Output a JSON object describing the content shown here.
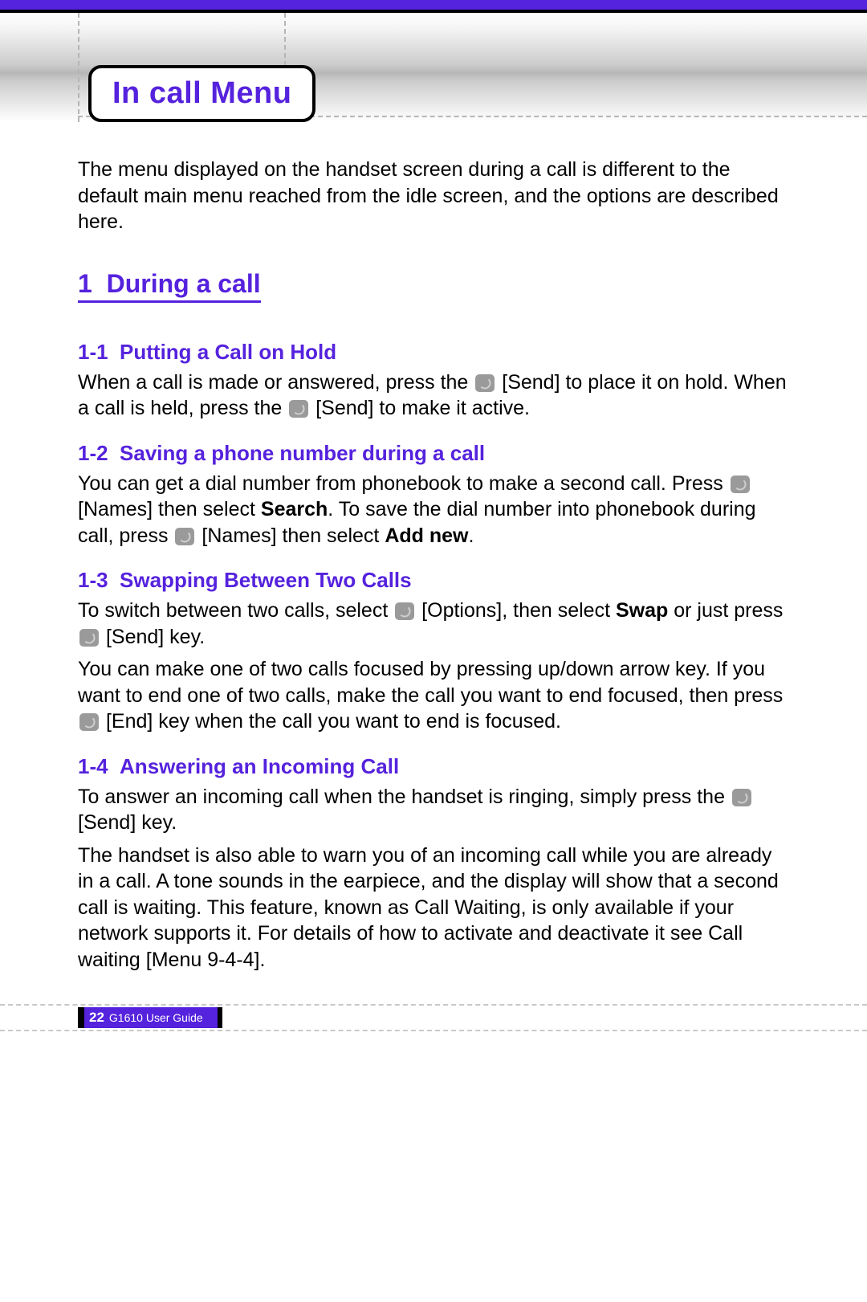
{
  "page": {
    "title": "In call Menu",
    "intro": "The menu displayed on the handset screen during a call is different to the default main menu reached from the idle screen, and the options are described here.",
    "section": {
      "number": "1",
      "heading": "During a call",
      "subsections": [
        {
          "number": "1-1",
          "heading": "Putting a Call on Hold",
          "text_before_icon1": "When a call is made or answered, press the ",
          "icon1_name": "send-key-icon",
          "label1": " [Send] to place it on hold. When a call is held, press the ",
          "icon2_name": "send-key-icon",
          "label2": " [Send] to make it active."
        },
        {
          "number": "1-2",
          "heading": "Saving a phone number during a call",
          "line1a": "You can get a dial number from phonebook to make a second call. Press ",
          "icon1_name": "names-key-icon",
          "line1b": " [Names] then select ",
          "bold1": "Search",
          "line1c": ". To save the dial number into phonebook during call, press ",
          "icon2_name": "names-key-icon",
          "line1d": " [Names] then select ",
          "bold2": "Add new",
          "line1e": "."
        },
        {
          "number": "1-3",
          "heading": "Swapping Between Two Calls",
          "p1a": "To switch between two calls, select ",
          "icon1_name": "options-key-icon",
          "p1b": " [Options], then select ",
          "bold1": "Swap",
          "p1c": " or just press ",
          "icon2_name": "send-key-icon",
          "p1d": " [Send] key.",
          "p2a": "You can make one of two calls focused by pressing up/down arrow key. If you want to end one of two calls, make the call you want to end focused, then press ",
          "icon3_name": "end-key-icon",
          "p2b": " [End] key when the call you want to end is focused."
        },
        {
          "number": "1-4",
          "heading": "Answering an Incoming Call",
          "p1a": "To answer an incoming call when the handset is ringing, simply press the ",
          "icon1_name": "send-key-icon",
          "p1b": " [Send] key.",
          "p2": "The handset is also able to warn you of an incoming call while you are already in a call. A tone sounds in the earpiece, and the display will show that a second call is waiting. This feature, known as Call Waiting, is only available if your network supports it. For details of how to activate and deactivate it see Call waiting [Menu 9-4-4]."
        }
      ]
    },
    "footer": {
      "page_number": "22",
      "guide_label": "G1610 User Guide"
    }
  }
}
